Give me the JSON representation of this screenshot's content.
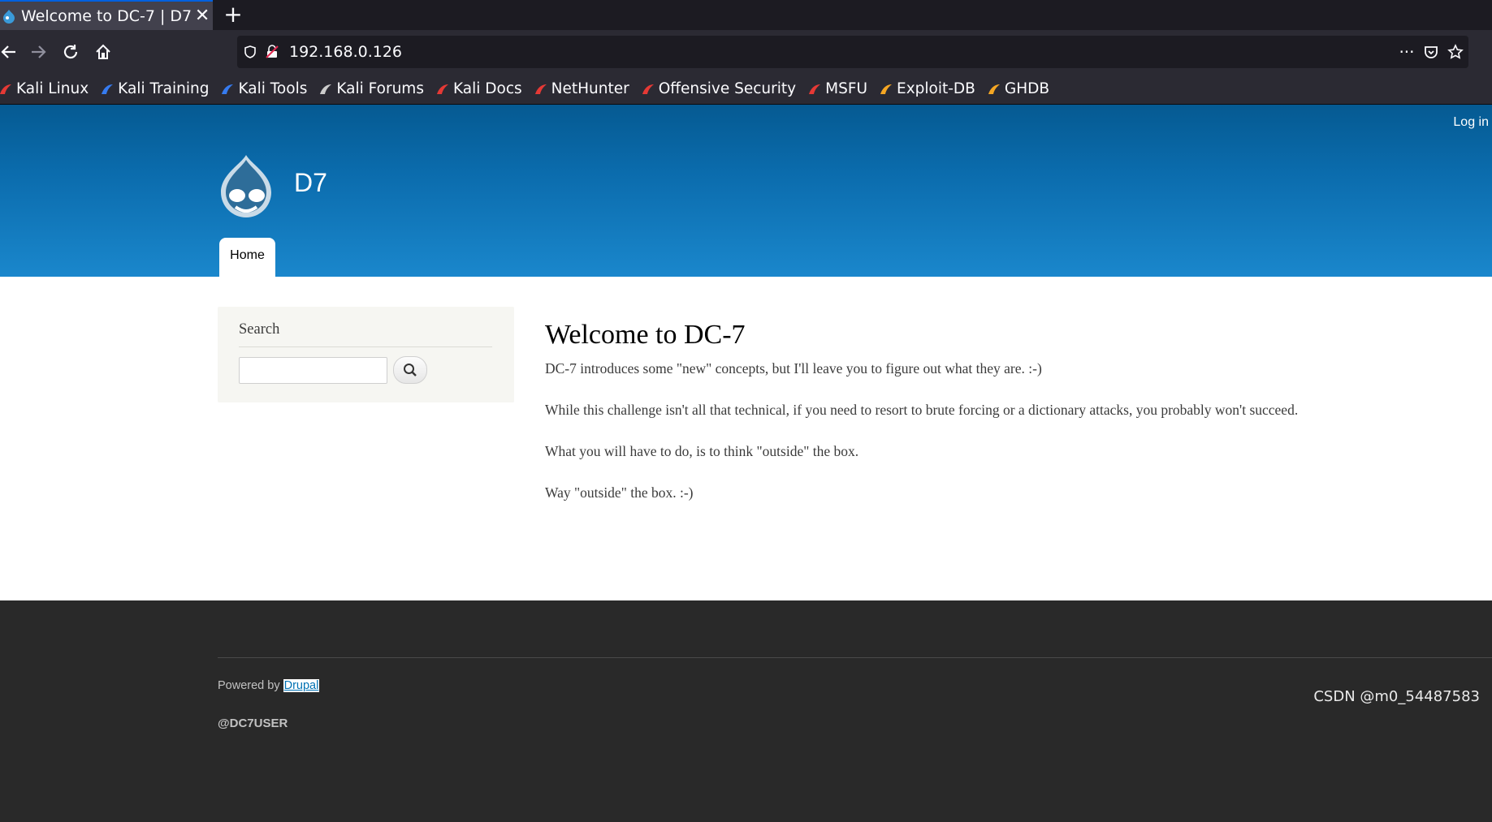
{
  "browser": {
    "tab_title": "Welcome to DC-7 | D7",
    "tab_close": "✕",
    "new_tab": "+",
    "url": "192.168.0.126",
    "more_menu": "···"
  },
  "bookmarks": [
    {
      "label": "Kali Linux",
      "icon_color": "#e53935"
    },
    {
      "label": "Kali Training",
      "icon_color": "#367bf0"
    },
    {
      "label": "Kali Tools",
      "icon_color": "#367bf0"
    },
    {
      "label": "Kali Forums",
      "icon_color": "#cccccc"
    },
    {
      "label": "Kali Docs",
      "icon_color": "#e53935"
    },
    {
      "label": "NetHunter",
      "icon_color": "#e53935"
    },
    {
      "label": "Offensive Security",
      "icon_color": "#e53935"
    },
    {
      "label": "MSFU",
      "icon_color": "#e53935"
    },
    {
      "label": "Exploit-DB",
      "icon_color": "#f5a623"
    },
    {
      "label": "GHDB",
      "icon_color": "#f5a623"
    }
  ],
  "site": {
    "login": "Log in",
    "name": "D7",
    "nav_home": "Home"
  },
  "sidebar": {
    "search_heading": "Search",
    "search_value": ""
  },
  "content": {
    "title": "Welcome to DC-7",
    "paragraphs": [
      "DC-7 introduces some \"new\" concepts, but I'll leave you to figure out what they are.  :-)",
      "While this challenge isn't all that technical, if you need to resort to brute forcing or a dictionary attacks, you probably won't succeed.",
      "What you will have to do, is to think \"outside\" the box.",
      "Way \"outside\" the box.  :-)"
    ]
  },
  "footer": {
    "powered_by": "Powered by",
    "drupal_link": "Drupal",
    "user": "@DC7USER"
  },
  "watermark": "CSDN @m0_54487583",
  "colors": {
    "header_blue": "#0b6cad",
    "footer_bg": "#292929",
    "browser_chrome": "#2b2a33"
  }
}
